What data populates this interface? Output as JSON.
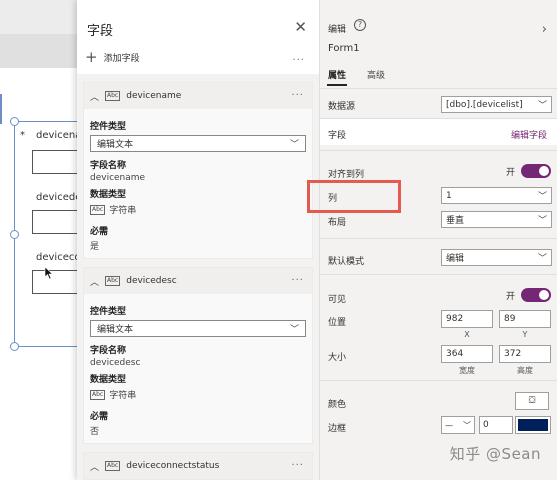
{
  "canvas": {
    "labels": [
      "devicena",
      "devicede",
      "deviceco"
    ],
    "required_mark": "*"
  },
  "fields_panel": {
    "title": "字段",
    "close_glyph": "✕",
    "add_field_label": "添加字段",
    "more_glyph": "···",
    "cards": [
      {
        "name": "devicename",
        "control_type_label": "控件类型",
        "control_type_value": "编辑文本",
        "field_name_label": "字段名称",
        "field_name_value": "devicename",
        "data_type_label": "数据类型",
        "data_type_value": "字符串",
        "required_label": "必需",
        "required_value": "是"
      },
      {
        "name": "devicedesc",
        "control_type_label": "控件类型",
        "control_type_value": "编辑文本",
        "field_name_label": "字段名称",
        "field_name_value": "devicedesc",
        "data_type_label": "数据类型",
        "data_type_value": "字符串",
        "required_label": "必需",
        "required_value": "否"
      },
      {
        "name": "deviceconnectstatus"
      }
    ]
  },
  "props_panel": {
    "edit_label": "编辑",
    "help_glyph": "?",
    "form_name": "Form1",
    "tabs": [
      "属性",
      "高级"
    ],
    "data_source_label": "数据源",
    "data_source_value": "[dbo].[devicelist]",
    "fields_label": "字段",
    "edit_fields_action": "编辑字段",
    "snap_columns_label": "对齐到列",
    "snap_columns_toggle": "开",
    "columns_label": "列",
    "columns_value": "1",
    "layout_label": "布局",
    "layout_value": "垂直",
    "default_mode_label": "默认模式",
    "default_mode_value": "编辑",
    "visible_label": "可见",
    "visible_toggle": "开",
    "position_label": "位置",
    "position_x": "982",
    "position_y": "89",
    "x_label": "X",
    "y_label": "Y",
    "size_label": "大小",
    "size_width": "364",
    "size_height": "372",
    "width_label": "宽度",
    "height_label": "高度",
    "color_label": "颜色",
    "border_label": "边框",
    "border_width": "0",
    "accent_color": "#742774",
    "border_color_value": "#00205b"
  },
  "watermark": "知乎 @Sean"
}
